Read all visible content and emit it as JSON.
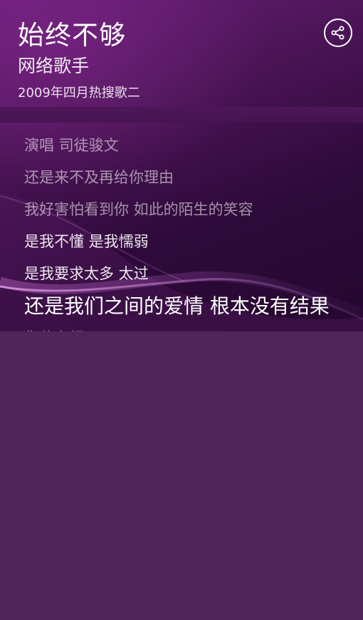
{
  "song": {
    "title": "始终不够",
    "artist": "网络歌手",
    "album": "2009年四月热搜歌二"
  },
  "actions": {
    "share_icon": "share-icon"
  },
  "lyrics": {
    "line_0": "演唱 司徒骏文",
    "line_1": "还是来不及再给你理由",
    "line_2": "我好害怕看到你 如此的陌生的笑容",
    "line_3": "是我不懂 是我懦弱",
    "line_4": "是我要求太多 太过",
    "line_5": "还是我们之间的爱情 根本没有结果",
    "line_6": "你什么都"
  },
  "colors": {
    "background_top": "#6a1e78",
    "background_bottom": "#50265a",
    "text": "#ffffff"
  }
}
